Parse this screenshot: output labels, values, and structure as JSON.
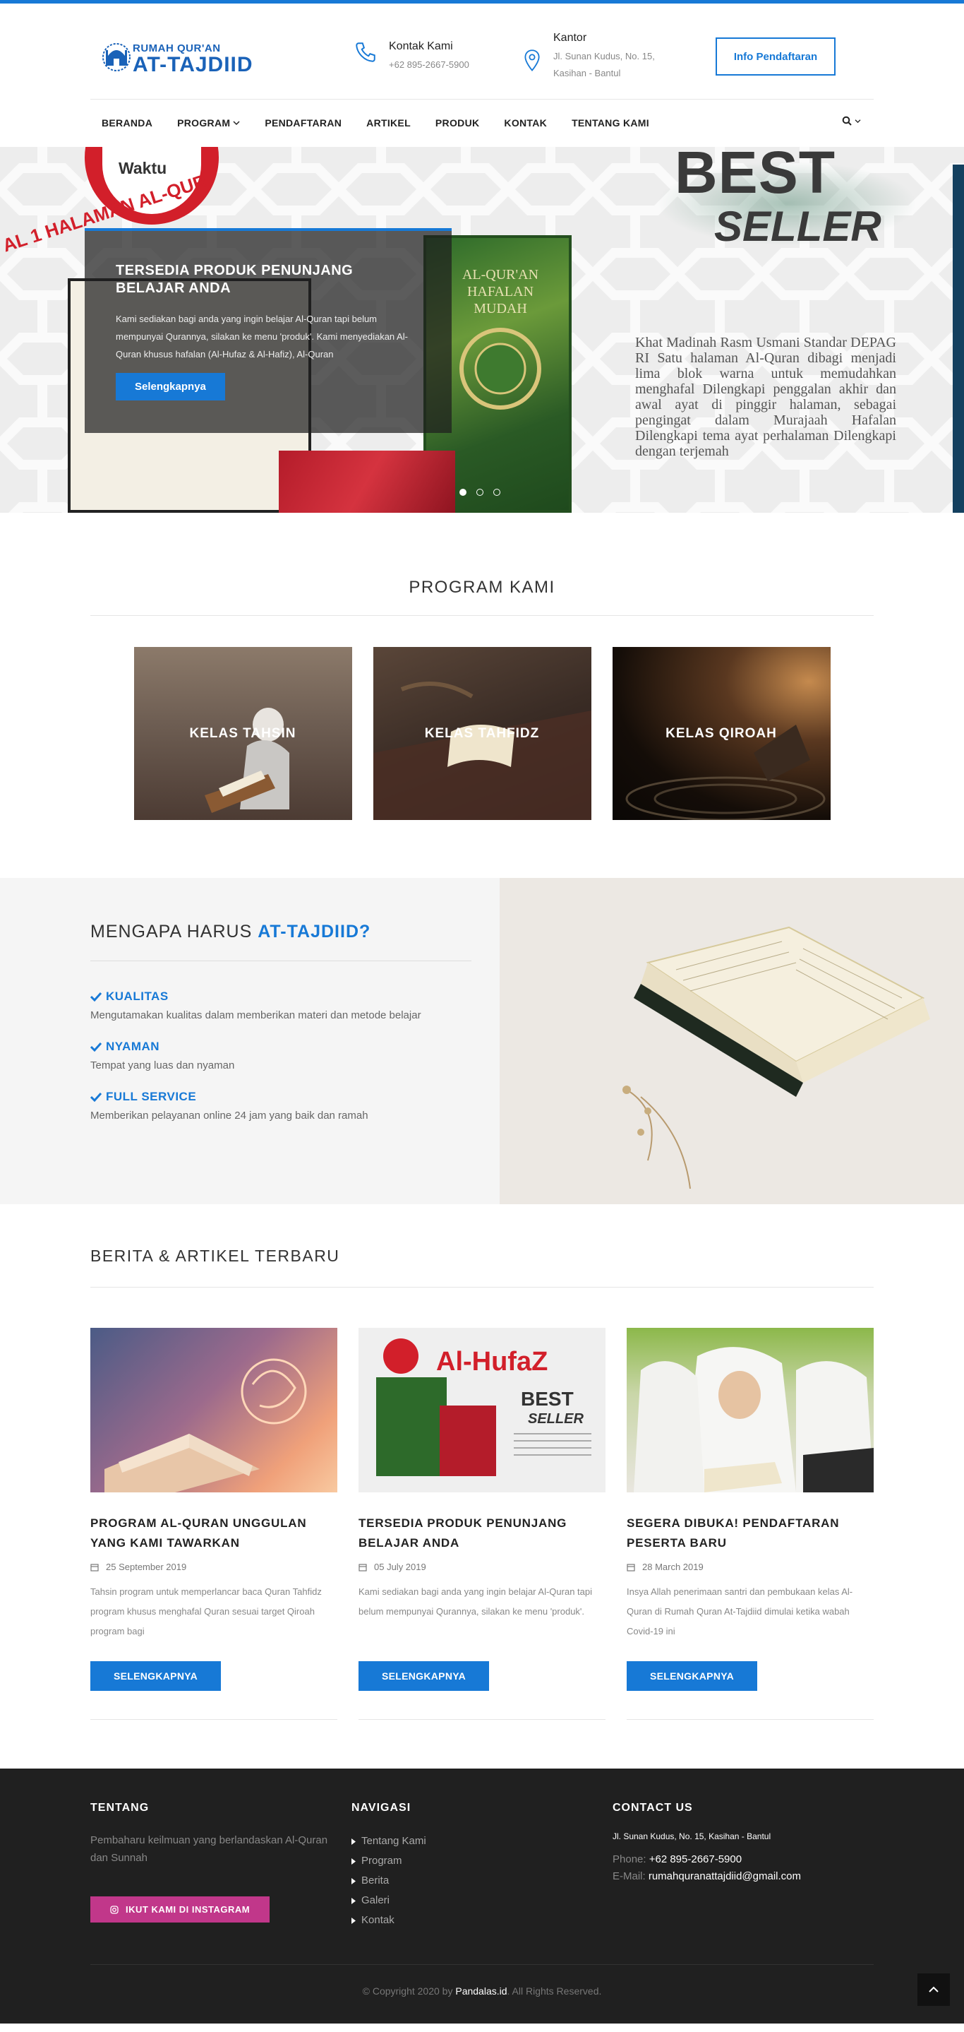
{
  "header": {
    "logo_line1": "RUMAH QUR'AN",
    "logo_line2": "AT-TAJDIID",
    "contact_title": "Kontak Kami",
    "contact_phone": "+62 895-2667-5900",
    "office_title": "Kantor",
    "office_line1": "Jl. Sunan Kudus, No. 15,",
    "office_line2": "Kasihan - Bantul",
    "info_button": "Info Pendaftaran"
  },
  "nav": {
    "items": [
      "BERANDA",
      "PROGRAM",
      "PENDAFTARAN",
      "ARTIKEL",
      "PRODUK",
      "KONTAK",
      "TENTANG KAMI"
    ]
  },
  "hero": {
    "title": "TERSEDIA PRODUK PENUNJANG BELAJAR ANDA",
    "text": "Kami sediakan bagi anda yang ingin belajar Al-Quran tapi belum mempunyai Qurannya, silakan ke menu 'produk'. Kami menyediakan Al-Quran khusus hafalan (Al-Hufaz & Al-Hafiz), Al-Quran",
    "button": "Selengkapnya",
    "badge_word": "Waktu",
    "badge_ribbon": "AL 1 HALAMAN AL-QUR",
    "book_title": "AL-QUR'AN HAFALAN MUDAH",
    "best": "BEST",
    "seller": "SELLER",
    "product_desc": "Khat Madinah Rasm Usmani Standar DEPAG RI Satu halaman Al-Quran dibagi menjadi lima blok warna untuk memudahkan menghafal Dilengkapi penggalan akhir dan awal ayat di pinggir halaman, sebagai pengingat dalam Murajaah Hafalan Dilengkapi tema ayat perhalaman Dilengkapi dengan terjemah"
  },
  "program": {
    "title": "PROGRAM KAMI",
    "cards": [
      "KELAS TAHSIN",
      "KELAS TAHFIDZ",
      "KELAS QIROAH"
    ]
  },
  "why": {
    "title_plain": "MENGAPA HARUS ",
    "title_accent": "AT-TAJDIID?",
    "items": [
      {
        "head": "KUALITAS",
        "body": "Mengutamakan kualitas dalam memberikan materi dan metode belajar"
      },
      {
        "head": "NYAMAN",
        "body": "Tempat yang luas dan nyaman"
      },
      {
        "head": "FULL SERVICE",
        "body": "Memberikan pelayanan online 24 jam yang baik dan ramah"
      }
    ]
  },
  "berita": {
    "title": "BERITA & ARTIKEL TERBARU",
    "articles": [
      {
        "title": "PROGRAM AL-QURAN UNGGULAN YANG KAMI TAWARKAN",
        "date": "25 September 2019",
        "text": "Tahsin program untuk memperlancar baca Quran Tahfidz program khusus menghafal Quran sesuai target Qiroah program bagi",
        "button": "SELENGKAPNYA"
      },
      {
        "title": "TERSEDIA PRODUK PENUNJANG BELAJAR ANDA",
        "date": "05 July 2019",
        "text": "Kami sediakan bagi anda yang ingin belajar Al-Quran tapi belum mempunyai Qurannya, silakan ke menu 'produk'.",
        "button": "SELENGKAPNYA"
      },
      {
        "title": "SEGERA DIBUKA! PENDAFTARAN PESERTA BARU",
        "date": "28 March 2019",
        "text": "Insya Allah penerimaan santri dan pembukaan kelas Al-Quran di Rumah Quran At-Tajdiid dimulai ketika wabah Covid-19 ini",
        "button": "SELENGKAPNYA"
      }
    ],
    "thumb2_brand": "Al-HufaZ",
    "thumb2_best": "BEST",
    "thumb2_seller": "SELLER"
  },
  "footer": {
    "about_title": "TENTANG",
    "about_text": "Pembaharu keilmuan yang berlandaskan Al-Quran dan Sunnah",
    "ig_button": "IKUT KAMI DI INSTAGRAM",
    "nav_title": "NAVIGASI",
    "nav_items": [
      "Tentang Kami",
      "Program",
      "Berita",
      "Galeri",
      "Kontak"
    ],
    "contact_title": "CONTACT US",
    "address": "Jl. Sunan Kudus, No. 15, Kasihan - Bantul",
    "phone_label": "Phone: ",
    "phone": "+62 895-2667-5900",
    "email_label": "E-Mail: ",
    "email": "rumahquranattajdiid@gmail.com",
    "copy_pre": "© Copyright 2020 by ",
    "copy_brand": "Pandalas.id",
    "copy_post": ". All Rights Reserved."
  },
  "colors": {
    "accent": "#1779d6",
    "footer_bg": "#202020",
    "instagram": "#c1378a"
  }
}
